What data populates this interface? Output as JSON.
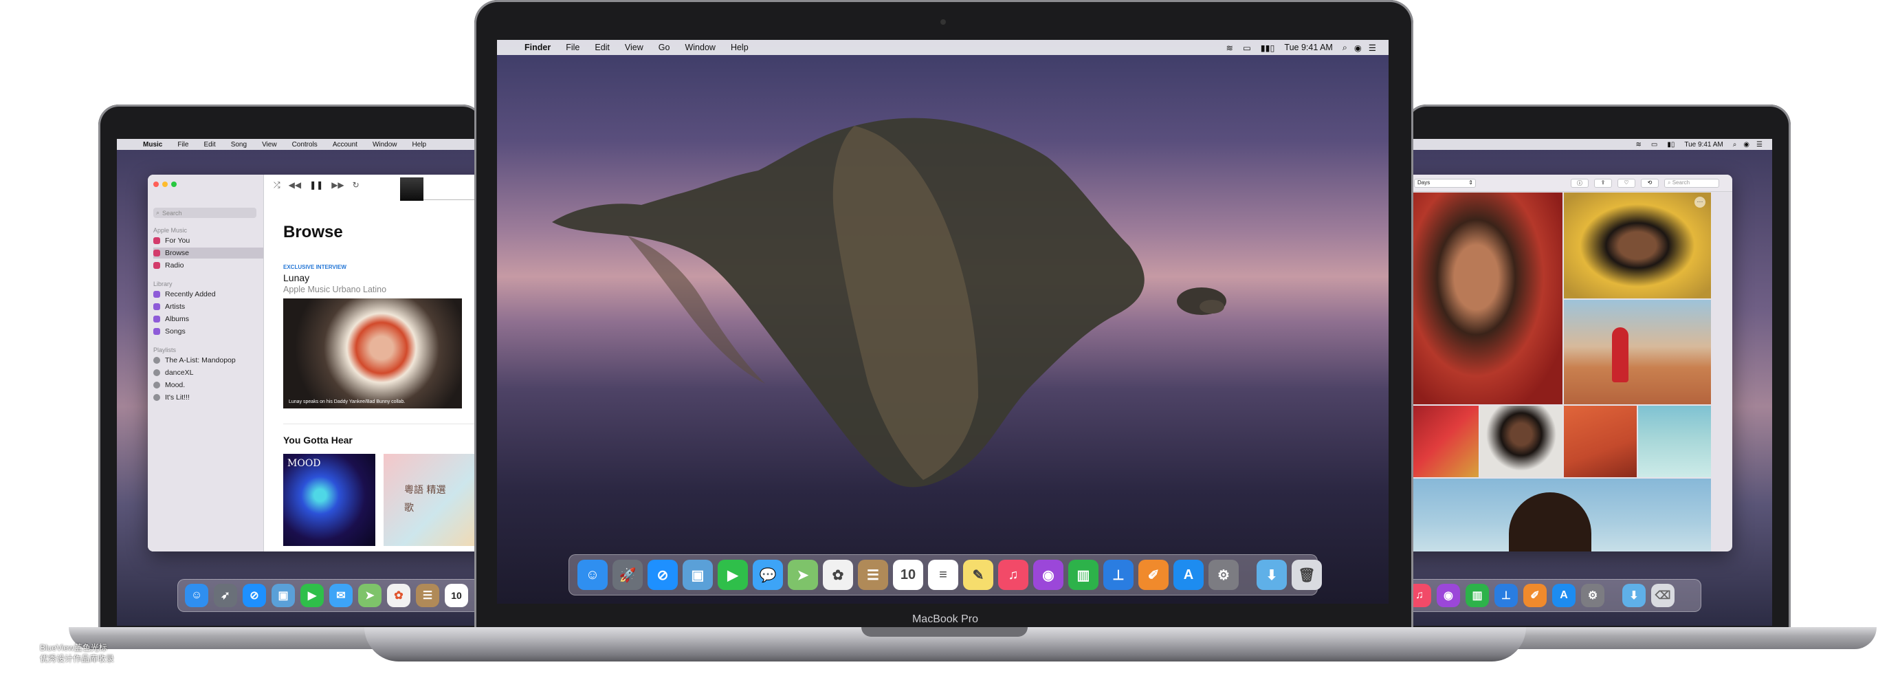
{
  "watermark": {
    "line1": "BlueView蓝色光标",
    "line2": "优秀设计作品库收录"
  },
  "left_macbook": {
    "menubar": {
      "apple": "",
      "app": "Music",
      "items": [
        "File",
        "Edit",
        "Song",
        "View",
        "Controls",
        "Account",
        "Window",
        "Help"
      ]
    },
    "music": {
      "search_placeholder": "Search",
      "sections": {
        "apple_music": "Apple Music",
        "library": "Library",
        "playlists": "Playlists"
      },
      "apple_music_items": [
        "For You",
        "Browse",
        "Radio"
      ],
      "library_items": [
        "Recently Added",
        "Artists",
        "Albums",
        "Songs"
      ],
      "playlist_items": [
        "The A-List: Mandopop",
        "danceXL",
        "Mood.",
        "It's Lit!!!"
      ],
      "browse_title": "Browse",
      "feature_label": "EXCLUSIVE INTERVIEW",
      "feature_title": "Lunay",
      "feature_subtitle": "Apple Music Urbano Latino",
      "feature_caption": "Lunay speaks on his Daddy Yankee/Bad Bunny collab.",
      "section_title": "You Gotta Hear",
      "album1_label": "MOOD",
      "album2_label": "粵語 精選 歌",
      "transport": {
        "shuffle": "⤮",
        "prev": "◀◀",
        "pause": "❚❚",
        "next": "▶▶",
        "repeat": "↻"
      }
    }
  },
  "center_macbook": {
    "model_label": "MacBook Pro",
    "menubar": {
      "apple": "",
      "app": "Finder",
      "items": [
        "File",
        "Edit",
        "View",
        "Go",
        "Window",
        "Help"
      ],
      "status": {
        "wifi": "wifi-icon",
        "airplay": "airplay-icon",
        "battery": "battery-icon",
        "clock": "Tue 9:41 AM",
        "spotlight": "search-icon",
        "siri": "siri-icon",
        "notifications": "list-icon"
      }
    },
    "dock": [
      {
        "name": "finder-icon",
        "color": "#2f8ff0",
        "glyph": "☺"
      },
      {
        "name": "launchpad-icon",
        "color": "#6a7079",
        "glyph": "🚀"
      },
      {
        "name": "safari-icon",
        "color": "#1e90ff",
        "glyph": "⊘"
      },
      {
        "name": "preview-icon",
        "color": "#5aa0d8",
        "glyph": "▣"
      },
      {
        "name": "facetime-icon",
        "color": "#2fbf4a",
        "glyph": "▶"
      },
      {
        "name": "messages-icon",
        "color": "#3da4f7",
        "glyph": "💬"
      },
      {
        "name": "maps-icon",
        "color": "#7ec36a",
        "glyph": "➤"
      },
      {
        "name": "photos-icon",
        "color": "#f1f1f1",
        "glyph": "✿"
      },
      {
        "name": "contacts-icon",
        "color": "#b08a58",
        "glyph": "☰"
      },
      {
        "name": "calendar-icon",
        "color": "#ffffff",
        "glyph": "10"
      },
      {
        "name": "reminders-icon",
        "color": "#ffffff",
        "glyph": "≡"
      },
      {
        "name": "notes-icon",
        "color": "#f6dd6c",
        "glyph": "✎"
      },
      {
        "name": "music-icon",
        "color": "#f24a68",
        "glyph": "♫"
      },
      {
        "name": "podcasts-icon",
        "color": "#9b47d9",
        "glyph": "◉"
      },
      {
        "name": "numbers-icon",
        "color": "#2db24a",
        "glyph": "▥"
      },
      {
        "name": "keynote-icon",
        "color": "#2a7de1",
        "glyph": "⊥"
      },
      {
        "name": "pages-icon",
        "color": "#f08a2c",
        "glyph": "✐"
      },
      {
        "name": "app-store-icon",
        "color": "#1d8cf0",
        "glyph": "A"
      },
      {
        "name": "system-preferences-icon",
        "color": "#7c7c82",
        "glyph": "⚙"
      },
      {
        "name": "downloads-folder-icon",
        "color": "#5fb0e8",
        "glyph": "⬇"
      },
      {
        "name": "trash-icon",
        "color": "#d9dbe0",
        "glyph": "🗑"
      }
    ]
  },
  "right_macbook": {
    "menubar": {
      "status": {
        "wifi": "wifi-icon",
        "airplay": "airplay-icon",
        "battery": "battery-icon",
        "clock": "Tue 9:41 AM",
        "spotlight": "search-icon",
        "siri": "siri-icon",
        "notifications": "list-icon"
      }
    },
    "photos": {
      "view_select": "Days",
      "search_placeholder": "Search",
      "more_button": "···"
    }
  }
}
